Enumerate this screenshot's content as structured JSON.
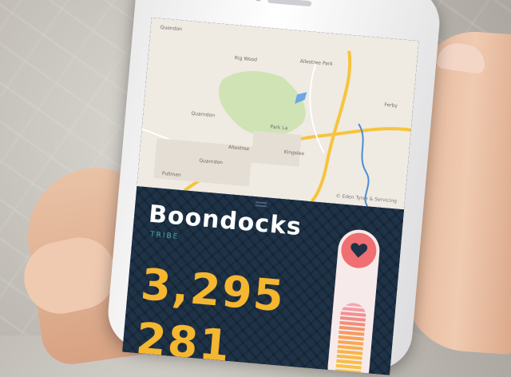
{
  "map": {
    "labels": [
      "Quendon",
      "Rig Wood",
      "Allestree Park",
      "Park La",
      "Quarndon",
      "Ferby",
      "Kingslee",
      "Allestree",
      "Quarndon",
      "Pullman"
    ],
    "attribution": "© Eden Tyres & Servicing"
  },
  "card": {
    "title": "Boondocks",
    "subtitle": "TRIBE",
    "count_primary": "3,295",
    "count_secondary_partial": "281",
    "heart_icon": "heart-icon"
  },
  "colors": {
    "panel": "#1f3348",
    "title": "#ffffff",
    "subtitle": "#4aa8a6",
    "numbers": "#f5b630",
    "heart_button": "#ef6f72"
  }
}
